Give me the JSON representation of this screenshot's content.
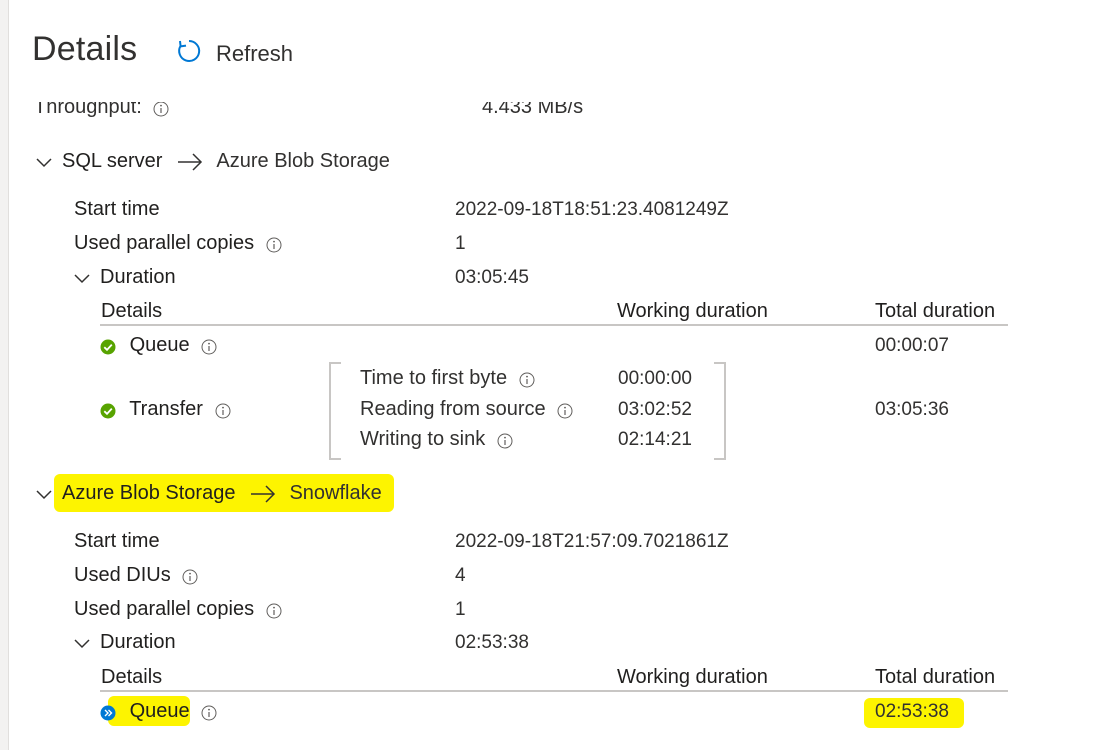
{
  "header": {
    "title": "Details",
    "refresh_label": "Refresh"
  },
  "throughput": {
    "label": "Throughput:",
    "value": "4.433 MB/s"
  },
  "section1": {
    "source": "SQL server",
    "sink": "Azure Blob Storage",
    "start_time_label": "Start time",
    "start_time_value": "2022-09-18T18:51:23.4081249Z",
    "parallel_label": "Used parallel copies",
    "parallel_value": "1",
    "duration_label": "Duration",
    "duration_value": "03:05:45",
    "table": {
      "col_details": "Details",
      "col_working": "Working duration",
      "col_total": "Total duration",
      "queue_label": "Queue",
      "queue_total": "00:00:07",
      "transfer_label": "Transfer",
      "transfer_total": "03:05:36",
      "sub": [
        {
          "label": "Time to first byte",
          "value": "00:00:00"
        },
        {
          "label": "Reading from source",
          "value": "03:02:52"
        },
        {
          "label": "Writing to sink",
          "value": "02:14:21"
        }
      ]
    }
  },
  "section2": {
    "source": "Azure Blob Storage",
    "sink": "Snowflake",
    "start_time_label": "Start time",
    "start_time_value": "2022-09-18T21:57:09.7021861Z",
    "diu_label": "Used DIUs",
    "diu_value": "4",
    "parallel_label": "Used parallel copies",
    "parallel_value": "1",
    "duration_label": "Duration",
    "duration_value": "02:53:38",
    "table": {
      "col_details": "Details",
      "col_working": "Working duration",
      "col_total": "Total duration",
      "queue_label": "Queue",
      "queue_total": "02:53:38"
    }
  },
  "colors": {
    "accent": "#0078d4",
    "success": "#57a300",
    "highlight": "#fdf400"
  },
  "icons": [
    "refresh-icon",
    "info-icon",
    "chevron-down-icon",
    "arrow-right-icon",
    "success-check-icon",
    "in-progress-icon"
  ]
}
